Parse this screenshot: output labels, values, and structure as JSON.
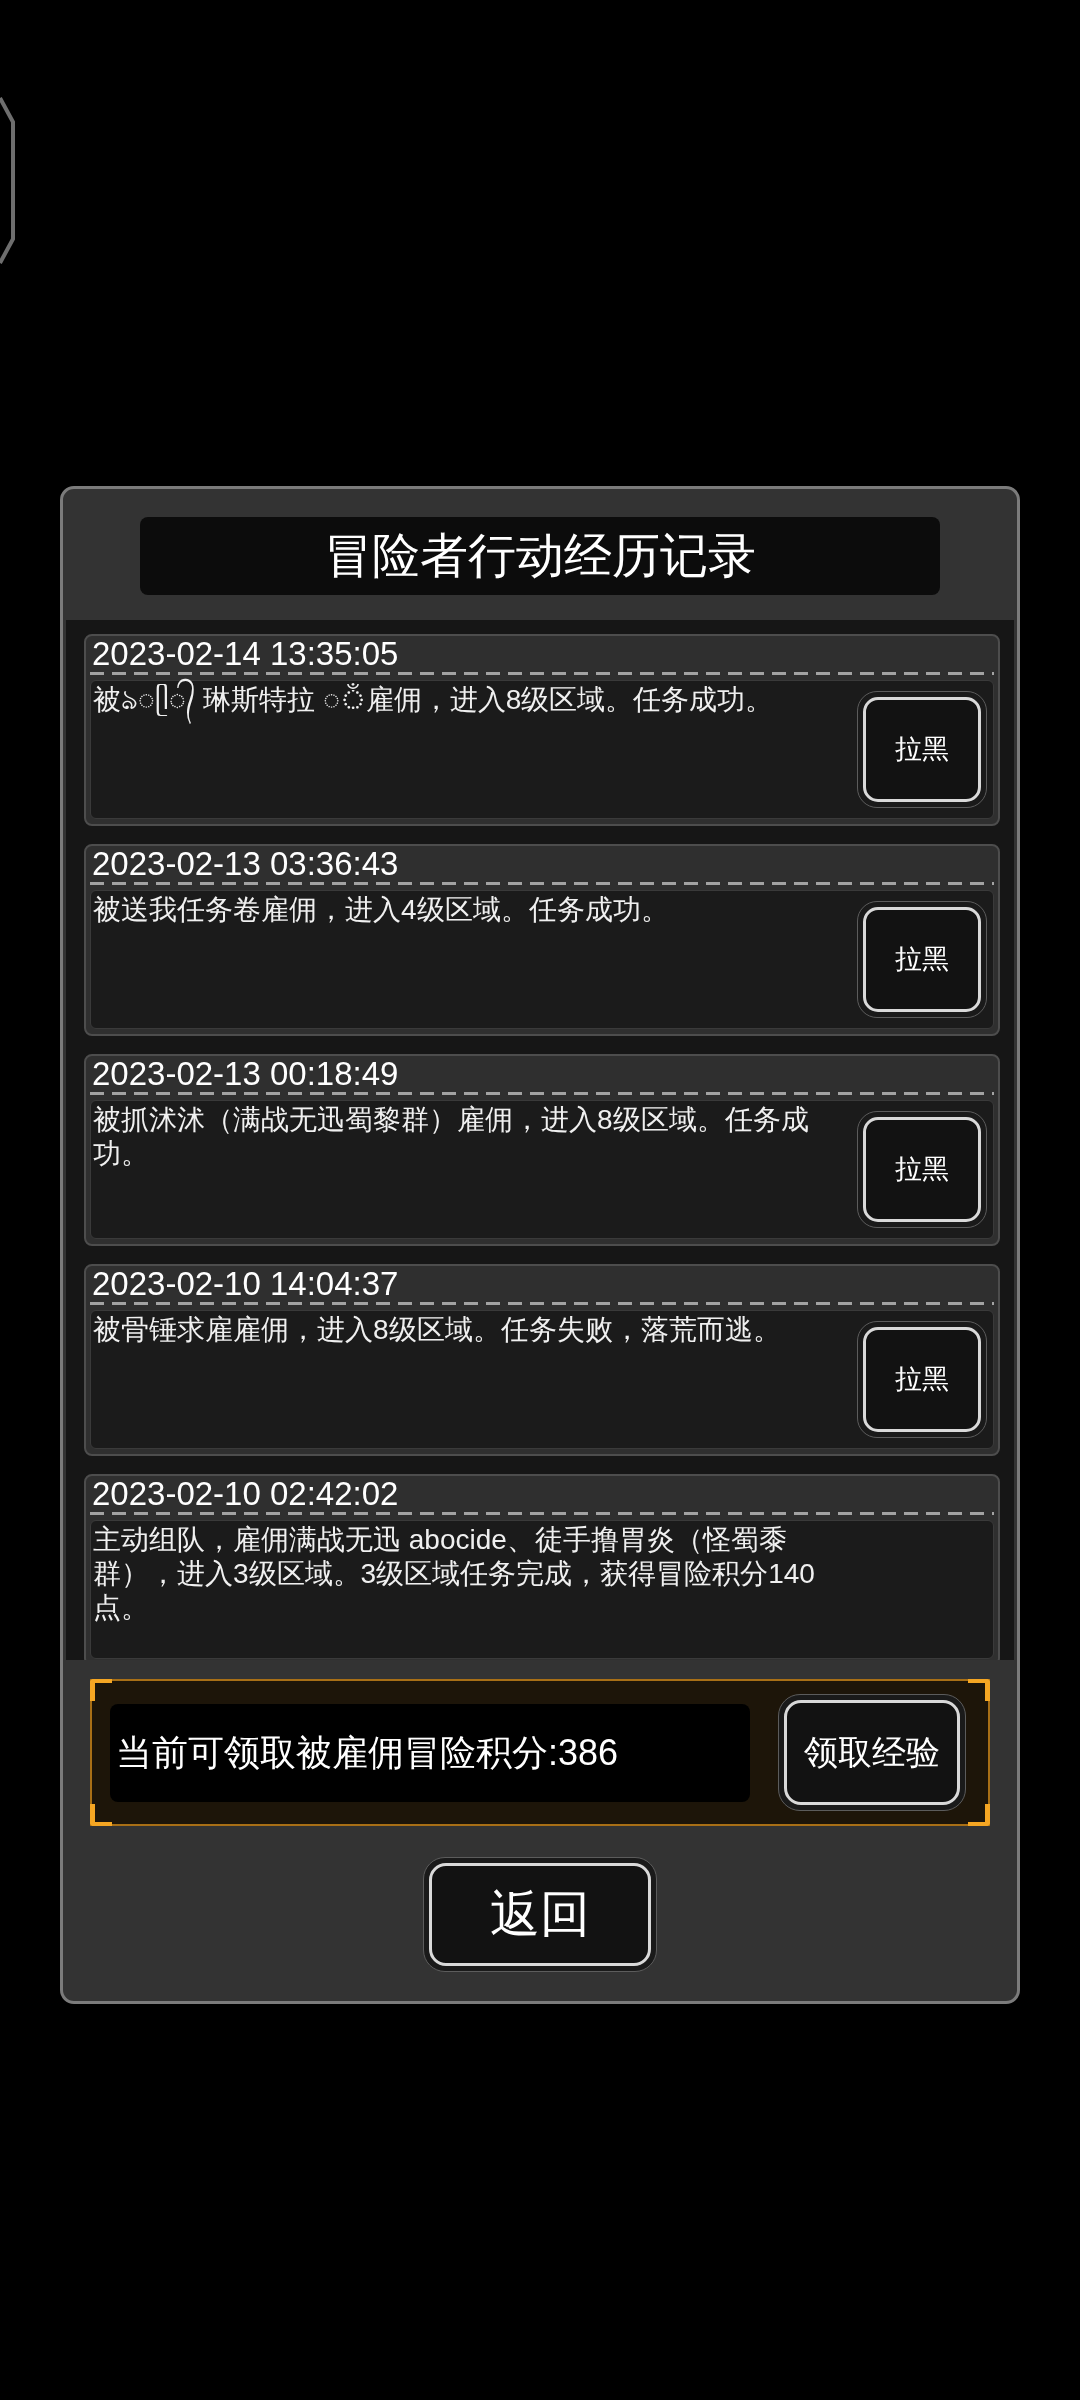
{
  "dialog": {
    "title": "冒险者行动经历记录",
    "records": [
      {
        "time": "2023-02-14 13:35:05",
        "text": "被ঌ◌ᥫ᭄ 琳斯特拉 ◌ঁ雇佣，进入8级区域。任务成功。",
        "block_button": "拉黑"
      },
      {
        "time": "2023-02-13 03:36:43",
        "text": "被送我任务卷雇佣，进入4级区域。任务成功。",
        "block_button": "拉黑"
      },
      {
        "time": "2023-02-13 00:18:49",
        "text": "被抓沭沭（满战无迅蜀黎群）雇佣，进入8级区域。任务成功。",
        "block_button": "拉黑"
      },
      {
        "time": "2023-02-10 14:04:37",
        "text": "被骨锤求雇雇佣，进入8级区域。任务失败，落荒而逃。",
        "block_button": "拉黑"
      },
      {
        "time": "2023-02-10 02:42:02",
        "text": "主动组队，雇佣满战无迅 abocide、徒手撸胃炎（怪蜀黍群），进入3级区域。3级区域任务完成，获得冒险积分140点。"
      }
    ],
    "points_panel": {
      "text": "当前可领取被雇佣冒险积分:386",
      "button": "领取经验"
    },
    "back_button": "返回"
  }
}
